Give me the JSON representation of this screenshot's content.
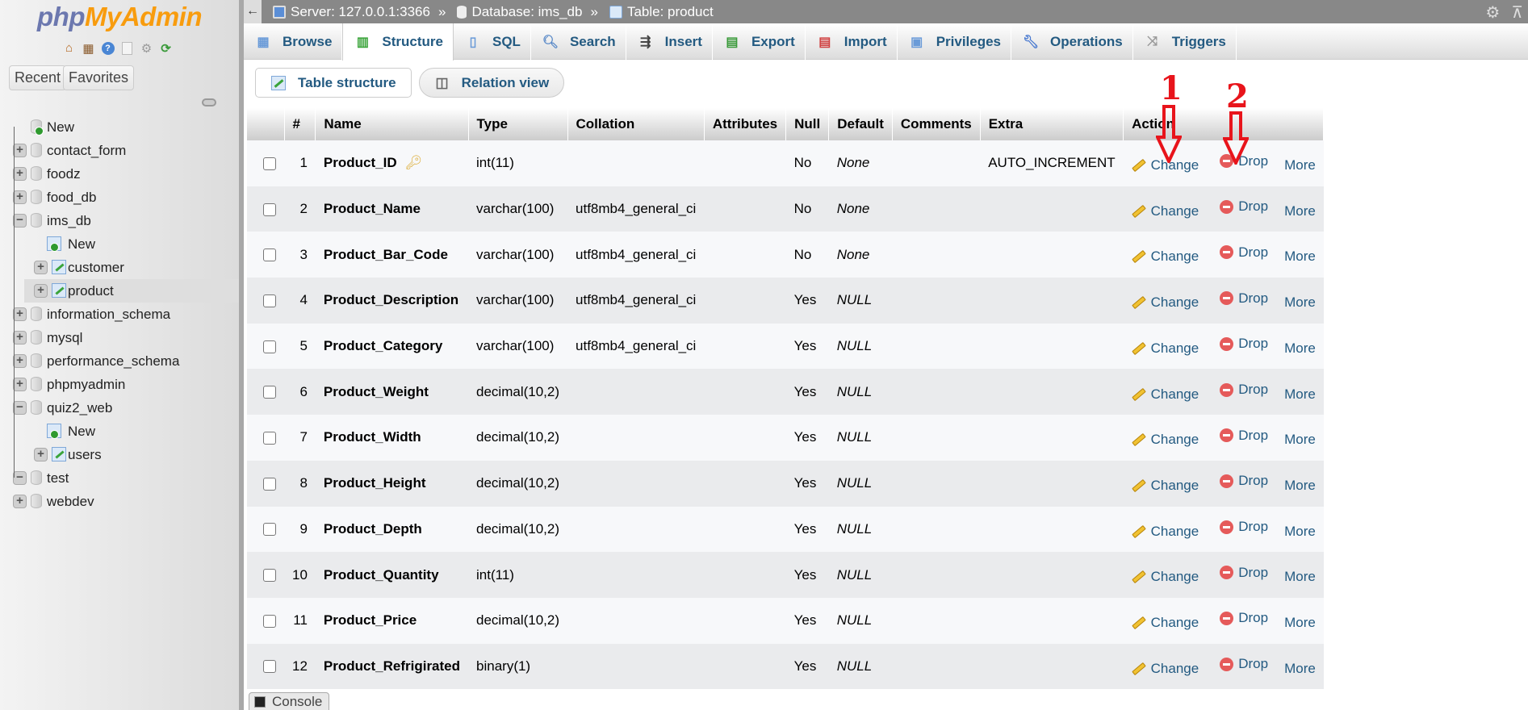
{
  "app": {
    "logo_php": "php",
    "logo_myadmin": "MyAdmin"
  },
  "sidebar": {
    "quick_icons": [
      "home-icon",
      "logout-icon",
      "help-icon",
      "documentation-icon",
      "settings-icon",
      "reload-icon"
    ],
    "recent_label": "Recent",
    "favorites_label": "Favorites",
    "tree": [
      {
        "label": "New",
        "type": "new-db",
        "level": 0
      },
      {
        "label": "contact_form",
        "type": "db",
        "level": 0,
        "state": "collapsed"
      },
      {
        "label": "foodz",
        "type": "db",
        "level": 0,
        "state": "collapsed"
      },
      {
        "label": "food_db",
        "type": "db",
        "level": 0,
        "state": "collapsed"
      },
      {
        "label": "ims_db",
        "type": "db",
        "level": 0,
        "state": "expanded"
      },
      {
        "label": "New",
        "type": "new-table",
        "level": 1
      },
      {
        "label": "customer",
        "type": "table",
        "level": 1,
        "state": "collapsed"
      },
      {
        "label": "product",
        "type": "table",
        "level": 1,
        "state": "collapsed",
        "selected": true
      },
      {
        "label": "information_schema",
        "type": "db",
        "level": 0,
        "state": "collapsed"
      },
      {
        "label": "mysql",
        "type": "db",
        "level": 0,
        "state": "collapsed"
      },
      {
        "label": "performance_schema",
        "type": "db",
        "level": 0,
        "state": "collapsed"
      },
      {
        "label": "phpmyadmin",
        "type": "db",
        "level": 0,
        "state": "collapsed"
      },
      {
        "label": "quiz2_web",
        "type": "db",
        "level": 0,
        "state": "expanded"
      },
      {
        "label": "New",
        "type": "new-table",
        "level": 1
      },
      {
        "label": "users",
        "type": "table",
        "level": 1,
        "state": "collapsed"
      },
      {
        "label": "test",
        "type": "db",
        "level": 0,
        "state": "expanded"
      },
      {
        "label": "webdev",
        "type": "db",
        "level": 0,
        "state": "collapsed"
      }
    ]
  },
  "breadcrumb": {
    "back": "←",
    "server": "Server: 127.0.0.1:3366",
    "database": "Database: ims_db",
    "table": "Table: product",
    "separator": "»"
  },
  "tabs": [
    {
      "label": "Browse",
      "icon": "browse-icon"
    },
    {
      "label": "Structure",
      "icon": "structure-icon",
      "active": true
    },
    {
      "label": "SQL",
      "icon": "sql-icon"
    },
    {
      "label": "Search",
      "icon": "search-icon"
    },
    {
      "label": "Insert",
      "icon": "insert-icon"
    },
    {
      "label": "Export",
      "icon": "export-icon"
    },
    {
      "label": "Import",
      "icon": "import-icon"
    },
    {
      "label": "Privileges",
      "icon": "privileges-icon"
    },
    {
      "label": "Operations",
      "icon": "operations-icon"
    },
    {
      "label": "Triggers",
      "icon": "triggers-icon"
    }
  ],
  "subtabs": [
    {
      "label": "Table structure",
      "active": true
    },
    {
      "label": "Relation view"
    }
  ],
  "table": {
    "headers": [
      "",
      "#",
      "Name",
      "Type",
      "Collation",
      "Attributes",
      "Null",
      "Default",
      "Comments",
      "Extra",
      "Action"
    ],
    "action_labels": {
      "change": "Change",
      "drop": "Drop",
      "more": "More"
    },
    "rows": [
      {
        "num": "1",
        "name": "Product_ID",
        "primary": true,
        "type": "int(11)",
        "collation": "",
        "attributes": "",
        "null": "No",
        "default": "None",
        "comments": "",
        "extra": "AUTO_INCREMENT"
      },
      {
        "num": "2",
        "name": "Product_Name",
        "type": "varchar(100)",
        "collation": "utf8mb4_general_ci",
        "attributes": "",
        "null": "No",
        "default": "None",
        "comments": "",
        "extra": ""
      },
      {
        "num": "3",
        "name": "Product_Bar_Code",
        "type": "varchar(100)",
        "collation": "utf8mb4_general_ci",
        "attributes": "",
        "null": "No",
        "default": "None",
        "comments": "",
        "extra": ""
      },
      {
        "num": "4",
        "name": "Product_Description",
        "type": "varchar(100)",
        "collation": "utf8mb4_general_ci",
        "attributes": "",
        "null": "Yes",
        "default": "NULL",
        "comments": "",
        "extra": ""
      },
      {
        "num": "5",
        "name": "Product_Category",
        "type": "varchar(100)",
        "collation": "utf8mb4_general_ci",
        "attributes": "",
        "null": "Yes",
        "default": "NULL",
        "comments": "",
        "extra": ""
      },
      {
        "num": "6",
        "name": "Product_Weight",
        "type": "decimal(10,2)",
        "collation": "",
        "attributes": "",
        "null": "Yes",
        "default": "NULL",
        "comments": "",
        "extra": ""
      },
      {
        "num": "7",
        "name": "Product_Width",
        "type": "decimal(10,2)",
        "collation": "",
        "attributes": "",
        "null": "Yes",
        "default": "NULL",
        "comments": "",
        "extra": ""
      },
      {
        "num": "8",
        "name": "Product_Height",
        "type": "decimal(10,2)",
        "collation": "",
        "attributes": "",
        "null": "Yes",
        "default": "NULL",
        "comments": "",
        "extra": ""
      },
      {
        "num": "9",
        "name": "Product_Depth",
        "type": "decimal(10,2)",
        "collation": "",
        "attributes": "",
        "null": "Yes",
        "default": "NULL",
        "comments": "",
        "extra": ""
      },
      {
        "num": "10",
        "name": "Product_Quantity",
        "type": "int(11)",
        "collation": "",
        "attributes": "",
        "null": "Yes",
        "default": "NULL",
        "comments": "",
        "extra": ""
      },
      {
        "num": "11",
        "name": "Product_Price",
        "type": "decimal(10,2)",
        "collation": "",
        "attributes": "",
        "null": "Yes",
        "default": "NULL",
        "comments": "",
        "extra": ""
      },
      {
        "num": "12",
        "name": "Product_Refrigirated",
        "type": "binary(1)",
        "collation": "",
        "attributes": "",
        "null": "Yes",
        "default": "NULL",
        "comments": "",
        "extra": ""
      }
    ]
  },
  "annotations": [
    {
      "label": "1",
      "target": "Change"
    },
    {
      "label": "2",
      "target": "Drop"
    }
  ],
  "annotation_color": "#e8141b",
  "console": {
    "label": "Console"
  }
}
